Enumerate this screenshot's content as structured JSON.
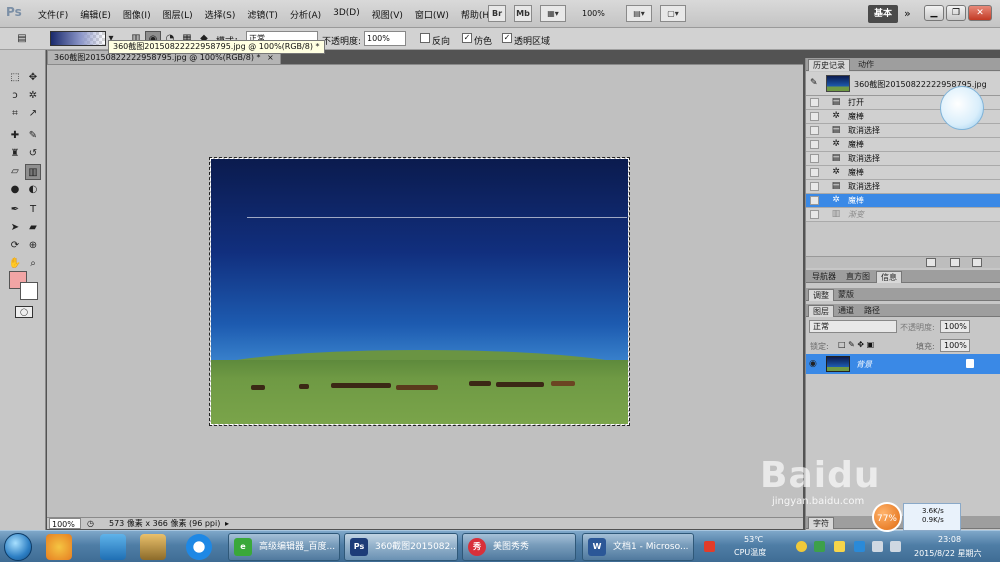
{
  "app": {
    "logo": "Ps"
  },
  "menu": [
    "文件(F)",
    "编辑(E)",
    "图像(I)",
    "图层(L)",
    "选择(S)",
    "滤镜(T)",
    "分析(A)",
    "3D(D)",
    "视图(V)",
    "窗口(W)",
    "帮助(H)"
  ],
  "menubar": {
    "bridge": "Br",
    "minibridge": "Mb",
    "zoom": "100%",
    "workspace": "基本",
    "more": "»"
  },
  "options": {
    "mode_label": "模式：",
    "mode_value": "正常",
    "opacity_label": "不透明度:",
    "opacity_value": "100%",
    "reverse_label": "反向",
    "dither_label": "仿色",
    "transparency_label": "透明区域",
    "reverse_checked": "",
    "dither_checked": "✓",
    "transparency_checked": "✓"
  },
  "tooltip": "360截图20150822222958795.jpg @ 100%(RGB/8) *",
  "document": {
    "tab_title": "360截图20150822222958795.jpg @ 100%(RGB/8) *",
    "close": "×"
  },
  "status": {
    "zoom": "100%",
    "info": "573 像素 x 366 像素 (96 ppi)"
  },
  "history": {
    "tabs": [
      "历史记录",
      "动作"
    ],
    "snapshot": "360截图20150822222958795.jpg",
    "items": [
      {
        "label": "打开",
        "state": "normal"
      },
      {
        "label": "魔棒",
        "state": "normal"
      },
      {
        "label": "取消选择",
        "state": "normal"
      },
      {
        "label": "魔棒",
        "state": "normal"
      },
      {
        "label": "取消选择",
        "state": "normal"
      },
      {
        "label": "魔棒",
        "state": "normal"
      },
      {
        "label": "取消选择",
        "state": "normal"
      },
      {
        "label": "魔棒",
        "state": "selected"
      },
      {
        "label": "渐变",
        "state": "undone"
      }
    ]
  },
  "nav_tabs": [
    "导航器",
    "直方图",
    "信息"
  ],
  "adjust_tabs": [
    "调整",
    "蒙版"
  ],
  "layers": {
    "tabs": [
      "图层",
      "通道",
      "路径"
    ],
    "blend_mode": "正常",
    "opacity_label": "不透明度:",
    "opacity_value": "100%",
    "lock_label": "锁定:",
    "fill_label": "填充:",
    "fill_value": "100%",
    "layer_name": "背景"
  },
  "bottom_tab": "字符",
  "overlay": {
    "watermark": "Baidu",
    "watermark_sub": "jingyan.baidu.com",
    "badge": "77%",
    "speed_up": "3.6K/s",
    "speed_down": "0.9K/s"
  },
  "taskbar": {
    "tasks": [
      {
        "label": "高级编辑器_百度...",
        "icon": "e",
        "color": "#3aa83a"
      },
      {
        "label": "360截图2015082...",
        "icon": "Ps",
        "color": "#1d3c78",
        "active": true
      },
      {
        "label": "美图秀秀",
        "icon": "秀",
        "color": "#d8303a"
      },
      {
        "label": "文档1 - Microso...",
        "icon": "W",
        "color": "#2b5797"
      }
    ],
    "temp": "53℃",
    "cpu": "CPU温度",
    "time": "23:08",
    "date": "2015/8/22 星期六"
  }
}
